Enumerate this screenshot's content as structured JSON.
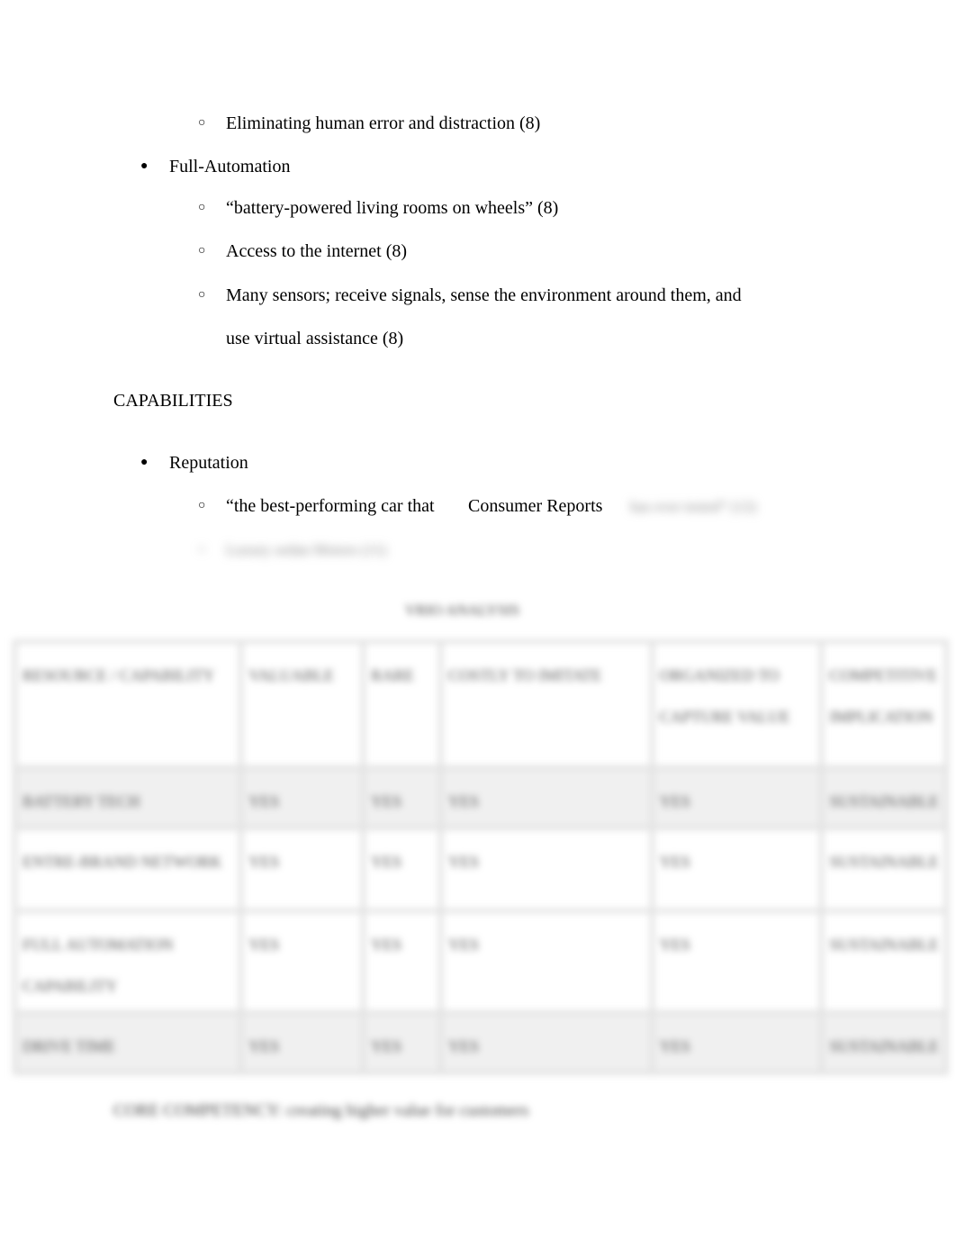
{
  "document": {
    "items": [
      {
        "type": "sub",
        "text": "Eliminating human error and distraction (8)"
      },
      {
        "type": "main",
        "text": "Full-Automation"
      },
      {
        "type": "sub",
        "text": "“battery-powered living rooms on wheels” (8)"
      },
      {
        "type": "sub",
        "text": "Access to the internet (8)"
      },
      {
        "type": "sub",
        "text": "Many sensors; receive signals, sense the environment around them, and"
      },
      {
        "type": "cont",
        "text": "use virtual assistance (8)"
      }
    ],
    "heading": "CAPABILITIES",
    "reputation": {
      "label": "Reputation",
      "quote_start": "“the best-performing car that",
      "quote_source": "Consumer Reports",
      "obscured_tail": "has ever tested” (12)",
      "obscured_next": "Luxury sedan Motors (11)"
    },
    "obscured": {
      "table_title": "VRIO ANALYSIS",
      "table_headers": [
        "RESOURCE / CAPABILITY",
        "VALUABLE",
        "RARE",
        "COSTLY TO IMITATE",
        "ORGANIZED TO CAPTURE VALUE",
        "COMPETITIVE IMPLICATION"
      ],
      "table_rows": [
        [
          "BATTERY TECH",
          "YES",
          "YES",
          "YES",
          "YES",
          "SUSTAINABLE"
        ],
        [
          "ENTRE-BRAND NETWORK",
          "YES",
          "YES",
          "YES",
          "YES",
          "SUSTAINABLE"
        ],
        [
          "FULL AUTOMATION CAPABILITY",
          "YES",
          "YES",
          "YES",
          "YES",
          "SUSTAINABLE"
        ],
        [
          "DRIVE TIME",
          "YES",
          "YES",
          "YES",
          "YES",
          "SUSTAINABLE"
        ]
      ],
      "footer": "CORE COMPETENCY: creating higher value for customers"
    },
    "bullets": {
      "main": "●",
      "sub": "○"
    }
  }
}
